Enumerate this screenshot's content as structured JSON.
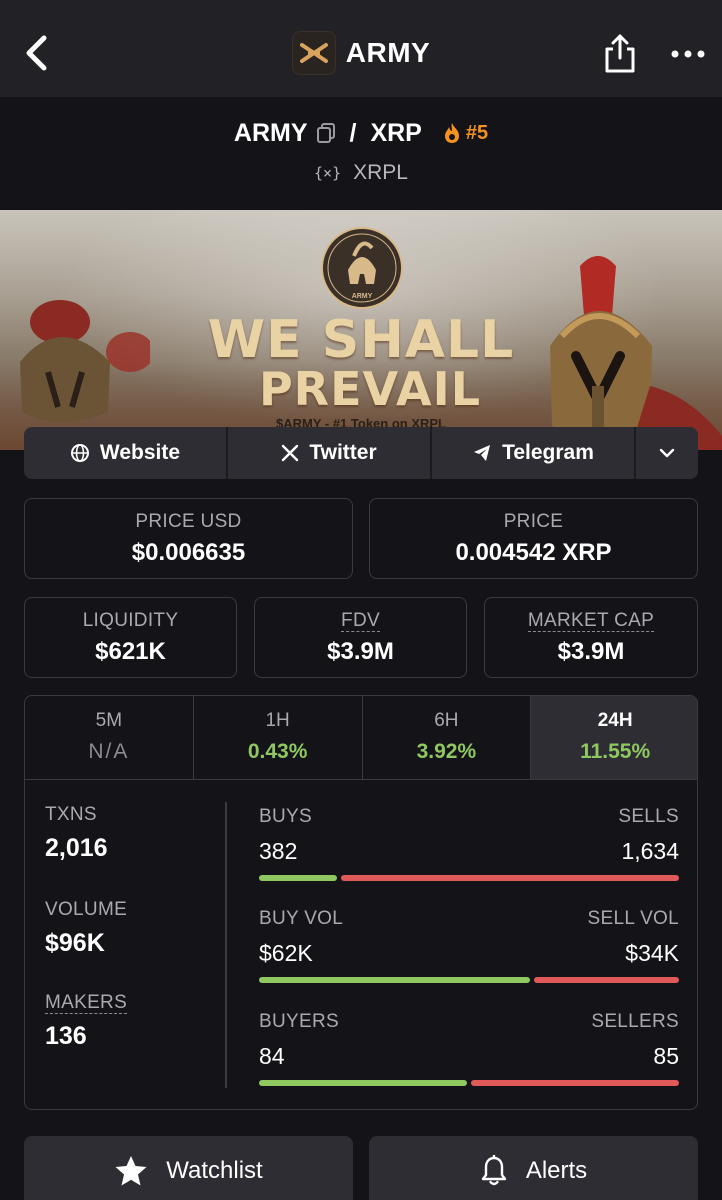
{
  "header": {
    "title": "ARMY",
    "back_icon": "chevron-left-icon",
    "share_icon": "share-icon",
    "more_icon": "more-icon"
  },
  "pair": {
    "base": "ARMY",
    "separator": "/",
    "quote": "XRP",
    "rank": "#5",
    "chain": "XRPL",
    "chain_icon": "{×}"
  },
  "banner": {
    "line1": "WE SHALL",
    "line2": "PREVAIL",
    "tagline": "$ARMY - #1 Token on XRPL",
    "emblem_text": "ARMY"
  },
  "links": {
    "website": "Website",
    "twitter": "Twitter",
    "telegram": "Telegram"
  },
  "stats": {
    "price_usd_label": "PRICE USD",
    "price_usd": "$0.006635",
    "price_label": "PRICE",
    "price": "0.004542 XRP",
    "liquidity_label": "LIQUIDITY",
    "liquidity": "$621K",
    "fdv_label": "FDV",
    "fdv": "$3.9M",
    "mcap_label": "MARKET CAP",
    "mcap": "$3.9M"
  },
  "timeframes": [
    {
      "label": "5M",
      "value": "N/A"
    },
    {
      "label": "1H",
      "value": "0.43%"
    },
    {
      "label": "6H",
      "value": "3.92%"
    },
    {
      "label": "24H",
      "value": "11.55%"
    }
  ],
  "txns": {
    "txns_label": "TXNS",
    "txns": "2,016",
    "volume_label": "VOLUME",
    "volume": "$96K",
    "makers_label": "MAKERS",
    "makers": "136",
    "buys_label": "BUYS",
    "sells_label": "SELLS",
    "buys": "382",
    "sells": "1,634",
    "buys_ratio": 0.19,
    "buy_vol_label": "BUY VOL",
    "sell_vol_label": "SELL VOL",
    "buy_vol": "$62K",
    "sell_vol": "$34K",
    "buy_vol_ratio": 0.65,
    "buyers_label": "BUYERS",
    "sellers_label": "SELLERS",
    "buyers": "84",
    "sellers": "85",
    "buyers_ratio": 0.5
  },
  "actions": {
    "watchlist": "Watchlist",
    "alerts": "Alerts"
  },
  "colors": {
    "positive": "#8fc761",
    "negative": "#e05a5a",
    "accent": "#f6921e"
  }
}
